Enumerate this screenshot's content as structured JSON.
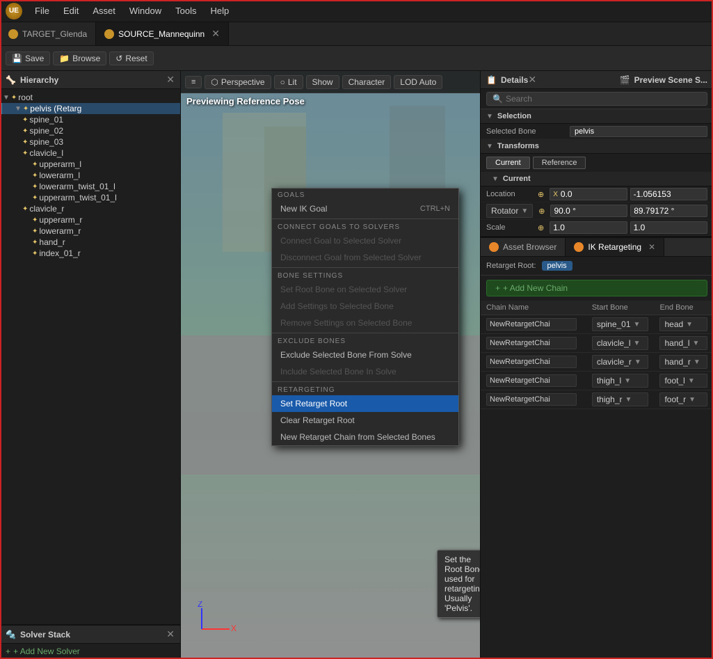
{
  "app": {
    "logo": "UE",
    "menu": [
      "File",
      "Edit",
      "Asset",
      "Window",
      "Tools",
      "Help"
    ]
  },
  "tabs": [
    {
      "id": "target",
      "icon": "orange",
      "label": "TARGET_Glenda",
      "active": false
    },
    {
      "id": "source",
      "icon": "orange",
      "label": "SOURCE_Mannequinn",
      "active": true
    }
  ],
  "toolbar": {
    "save_label": "Save",
    "browse_label": "Browse",
    "reset_label": "Reset"
  },
  "hierarchy": {
    "title": "Hierarchy",
    "items": [
      {
        "id": "root",
        "label": "root",
        "indent": 0,
        "has_arrow": true,
        "expanded": true
      },
      {
        "id": "pelvis",
        "label": "pelvis (Retarg",
        "indent": 1,
        "has_arrow": true,
        "expanded": true,
        "selected": true
      },
      {
        "id": "spine_01",
        "label": "spine_01",
        "indent": 2,
        "has_arrow": false
      },
      {
        "id": "spine_02",
        "label": "spine_02",
        "indent": 2,
        "has_arrow": false
      },
      {
        "id": "spine_03",
        "label": "spine_03",
        "indent": 2,
        "has_arrow": false
      },
      {
        "id": "clavicle_l",
        "label": "clavicle_l",
        "indent": 2,
        "has_arrow": false
      },
      {
        "id": "upperarm_l",
        "label": "upperarm_l",
        "indent": 3,
        "has_arrow": false
      },
      {
        "id": "lowerarm_l",
        "label": "lowerarm_l",
        "indent": 3,
        "has_arrow": false
      },
      {
        "id": "lowerarm_twist_01",
        "label": "lowerarm_twist_01_l",
        "indent": 3,
        "has_arrow": false
      },
      {
        "id": "upperarm_twist_01",
        "label": "upperarm_twist_01_l",
        "indent": 3,
        "has_arrow": false
      },
      {
        "id": "clavicle_r",
        "label": "clavicle_r",
        "indent": 2,
        "has_arrow": false
      },
      {
        "id": "upperarm_r",
        "label": "upperarm_r",
        "indent": 3,
        "has_arrow": false
      },
      {
        "id": "lowerarm_r",
        "label": "lowerarm_r",
        "indent": 3,
        "has_arrow": false
      },
      {
        "id": "hand_r",
        "label": "hand_r",
        "indent": 3,
        "has_arrow": false
      },
      {
        "id": "index_01_r",
        "label": "index_01_r",
        "indent": 3,
        "has_arrow": false
      }
    ]
  },
  "context_menu": {
    "sections": [
      {
        "label": "GOALS",
        "items": [
          {
            "label": "New IK Goal",
            "shortcut": "CTRL+N",
            "disabled": false
          }
        ]
      },
      {
        "label": "CONNECT GOALS TO SOLVERS",
        "items": [
          {
            "label": "Connect Goal to Selected Solver",
            "disabled": true
          },
          {
            "label": "Disconnect Goal from Selected Solver",
            "disabled": true
          }
        ]
      },
      {
        "label": "BONE SETTINGS",
        "items": [
          {
            "label": "Set Root Bone on Selected Solver",
            "disabled": true
          },
          {
            "label": "Add Settings to Selected Bone",
            "disabled": true
          },
          {
            "label": "Remove Settings on Selected Bone",
            "disabled": true
          }
        ]
      },
      {
        "label": "EXCLUDE BONES",
        "items": [
          {
            "label": "Exclude Selected Bone From Solve",
            "disabled": false
          },
          {
            "label": "Include Selected Bone In Solve",
            "disabled": true
          }
        ]
      },
      {
        "label": "RETARGETING",
        "items": [
          {
            "label": "Set Retarget Root",
            "active": true
          },
          {
            "label": "Clear Retarget Root",
            "disabled": false
          },
          {
            "label": "New Retarget Chain from Selected Bones",
            "disabled": false
          }
        ]
      }
    ]
  },
  "tooltip": {
    "text": "Set the Root Bone used for retargeting. Usually 'Pelvis'."
  },
  "viewport": {
    "label": "Previewing Reference Pose",
    "perspective_label": "Perspective",
    "lit_label": "Lit",
    "show_label": "Show",
    "character_label": "Character",
    "lod_label": "LOD Auto"
  },
  "details": {
    "title": "Details",
    "search_placeholder": "Search",
    "preview_scene_label": "Preview Scene S...",
    "selection": {
      "label": "Selection",
      "bone_label": "Selected Bone",
      "bone_value": "pelvis"
    },
    "transforms": {
      "label": "Transforms",
      "current_btn": "Current",
      "reference_btn": "Reference",
      "current_section": "Current",
      "location_label": "Location",
      "location_x": "0.0",
      "location_y": "-1.056153",
      "rotation_label": "Rotator",
      "rotation_x": "90.0 °",
      "rotation_y": "89.79172 °",
      "scale_label": "Scale",
      "scale_x": "1.0",
      "scale_y": "1.0"
    }
  },
  "asset_browser": {
    "label": "Asset Browser"
  },
  "ik_retargeting": {
    "label": "IK Retargeting",
    "retarget_root_label": "Retarget Root:",
    "retarget_root_value": "pelvis",
    "add_chain_label": "+ Add New Chain",
    "table_headers": [
      "Chain Name",
      "Start Bone",
      "End Bone"
    ],
    "chains": [
      {
        "name": "NewRetargetChai",
        "start": "spine_01",
        "end": "head",
        "start_arrow": true,
        "end_arrow": true
      },
      {
        "name": "NewRetargetChai",
        "start": "clavicle_l",
        "end": "hand_l",
        "start_arrow": true,
        "end_arrow": true
      },
      {
        "name": "NewRetargetChai",
        "start": "clavicle_r",
        "end": "hand_r",
        "start_arrow": true,
        "end_arrow": true
      },
      {
        "name": "NewRetargetChai",
        "start": "thigh_l",
        "end": "foot_l",
        "start_arrow": true,
        "end_arrow": true
      },
      {
        "name": "NewRetargetChai",
        "start": "thigh_r",
        "end": "foot_r",
        "start_arrow": true,
        "end_arrow": true
      }
    ]
  },
  "solver_stack": {
    "title": "Solver Stack",
    "add_label": "+ Add New Solver"
  }
}
